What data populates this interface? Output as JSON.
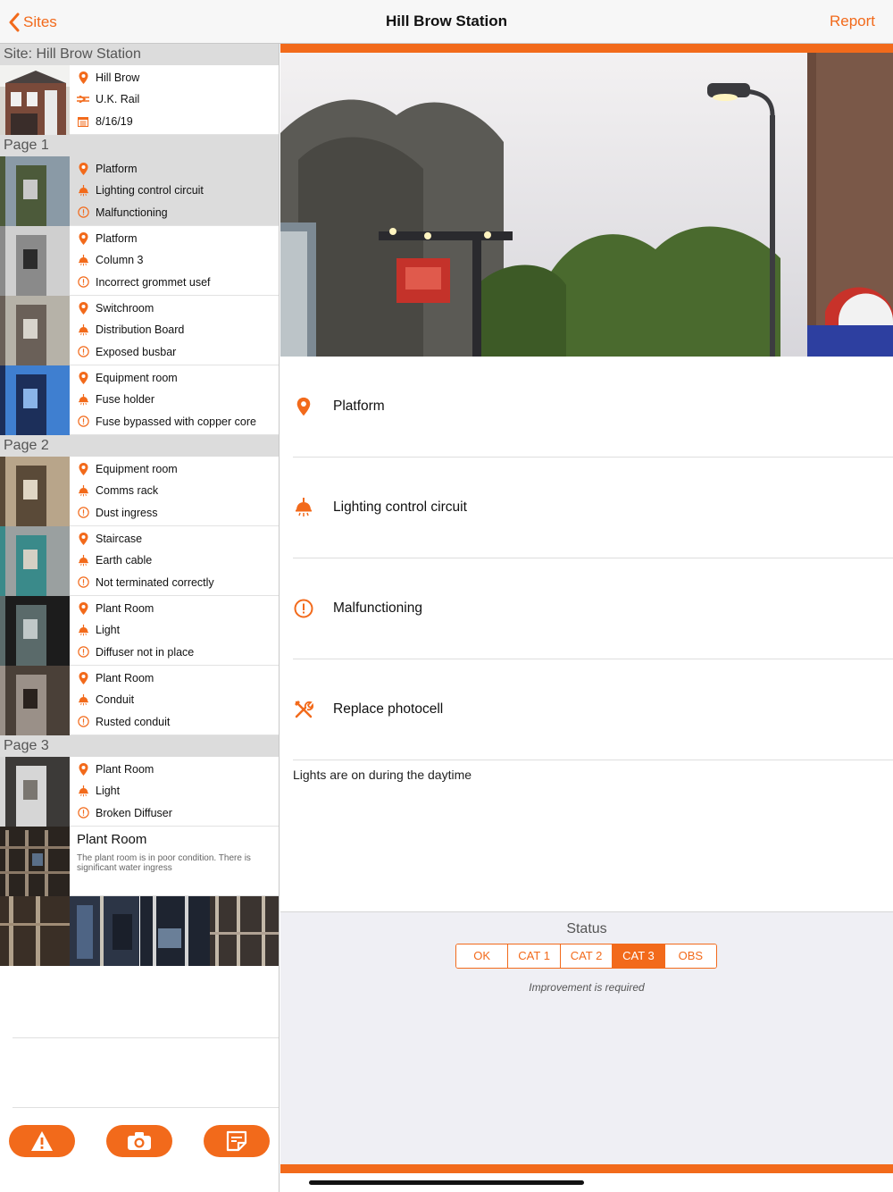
{
  "navbar": {
    "back_label": "Sites",
    "title": "Hill Brow Station",
    "report_label": "Report"
  },
  "colors": {
    "accent": "#f26a1b",
    "section_header": "#dcdcdc",
    "status_background": "#efeff4"
  },
  "sidebar": {
    "site_header": "Site: Hill Brow Station",
    "site": {
      "location": "Hill Brow",
      "operator": "U.K. Rail",
      "date": "8/16/19",
      "icons": [
        "location-pin-icon",
        "rail-logo-icon",
        "calendar-icon"
      ]
    },
    "pages": [
      {
        "header": "Page 1",
        "entries": [
          {
            "location": "Platform",
            "item": "Lighting control circuit",
            "issue": "Malfunctioning",
            "selected": true
          },
          {
            "location": "Platform",
            "item": "Column 3",
            "issue": "Incorrect grommet usef"
          },
          {
            "location": "Switchroom",
            "item": "Distribution Board",
            "issue": "Exposed busbar"
          },
          {
            "location": "Equipment room",
            "item": "Fuse holder",
            "issue": "Fuse bypassed with copper core"
          }
        ]
      },
      {
        "header": "Page 2",
        "entries": [
          {
            "location": "Equipment room",
            "item": "Comms rack",
            "issue": "Dust ingress"
          },
          {
            "location": "Staircase",
            "item": "Earth cable",
            "issue": "Not terminated correctly"
          },
          {
            "location": "Plant Room",
            "item": "Light",
            "issue": "Diffuser not in place"
          },
          {
            "location": "Plant Room",
            "item": "Conduit",
            "issue": "Rusted conduit"
          }
        ]
      },
      {
        "header": "Page 3",
        "entries": [
          {
            "location": "Plant Room",
            "item": "Light",
            "issue": "Broken Diffuser"
          }
        ],
        "note": {
          "title": "Plant Room",
          "text": "The plant room is in poor condition. There is significant water ingress"
        }
      }
    ],
    "toolbar": [
      "warning-icon",
      "camera-icon",
      "note-icon"
    ]
  },
  "detail": {
    "location": "Platform",
    "item": "Lighting control circuit",
    "issue": "Malfunctioning",
    "action": "Replace photocell",
    "notes": "Lights are on during the daytime",
    "status": {
      "title": "Status",
      "options": [
        "OK",
        "CAT 1",
        "CAT 2",
        "CAT 3",
        "OBS"
      ],
      "selected": "CAT 3",
      "description": "Improvement is required"
    }
  }
}
